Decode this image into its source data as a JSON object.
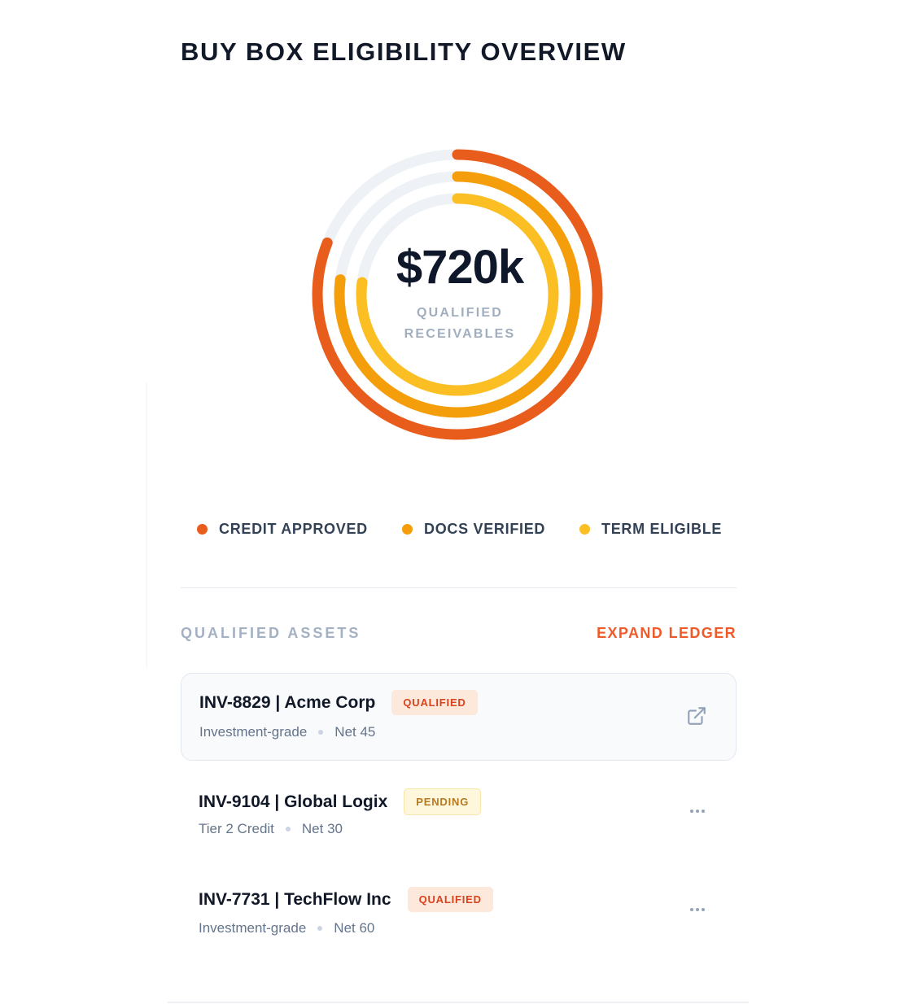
{
  "header": {
    "title": "BUY BOX ELIGIBILITY OVERVIEW"
  },
  "summary": {
    "amount": "$720k",
    "label_line1": "QUALIFIED",
    "label_line2": "RECEIVABLES"
  },
  "rings": [
    {
      "name": "CREDIT APPROVED",
      "fraction": 0.81,
      "color": "#e85d1c"
    },
    {
      "name": "DOCS VERIFIED",
      "fraction": 0.77,
      "color": "#f59e0b"
    },
    {
      "name": "TERM ELIGIBLE",
      "fraction": 0.77,
      "color": "#fbbf24"
    }
  ],
  "ring_track_color": "#eef2f7",
  "legend": [
    {
      "label": "CREDIT APPROVED",
      "color": "#e85d1c"
    },
    {
      "label": "DOCS VERIFIED",
      "color": "#f59e0b"
    },
    {
      "label": "TERM ELIGIBLE",
      "color": "#fbbf24"
    }
  ],
  "assets": {
    "section_title": "QUALIFIED ASSETS",
    "expand_label": "EXPAND LEDGER",
    "rows": [
      {
        "title": "INV-8829 | Acme Corp",
        "status": "QUALIFIED",
        "meta": [
          "Investment-grade",
          "Net 45"
        ],
        "action_icon": "external-link-icon"
      },
      {
        "title": "INV-9104 | Global Logix",
        "status": "PENDING",
        "meta": [
          "Tier 2 Credit",
          "Net 30"
        ],
        "action_icon": "more-icon"
      },
      {
        "title": "INV-7731 | TechFlow Inc",
        "status": "QUALIFIED",
        "meta": [
          "Investment-grade",
          "Net 60"
        ],
        "action_icon": "more-icon"
      }
    ]
  },
  "colors": {
    "accent": "#ef5a2a",
    "qualified_badge_text": "#d9431b",
    "pending_badge_text": "#b7791f"
  }
}
